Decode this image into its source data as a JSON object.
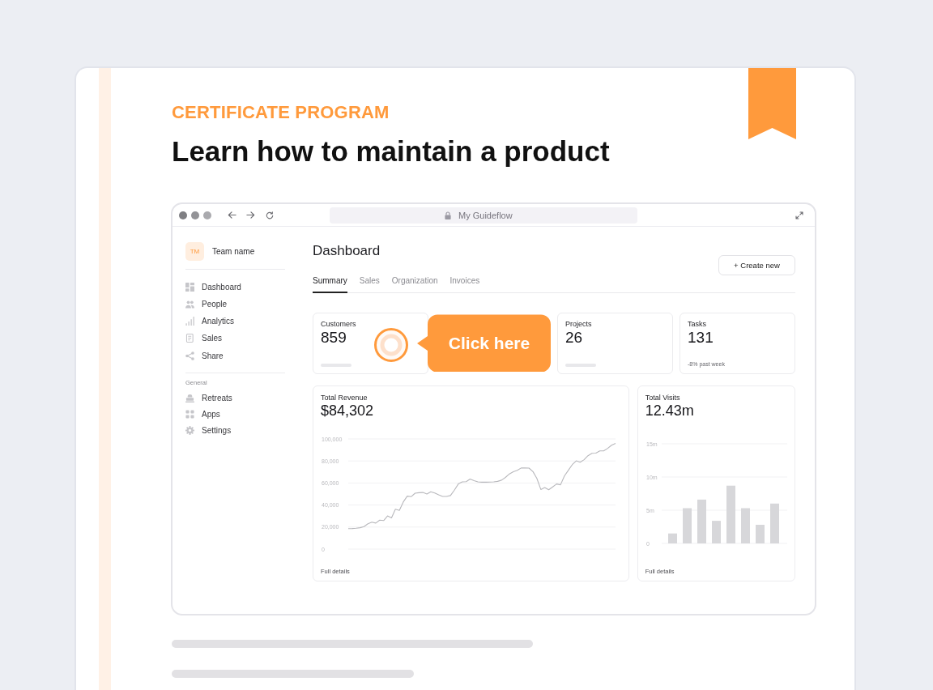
{
  "certificate": {
    "eyebrow": "CERTIFICATE PROGRAM",
    "title": "Learn how to maintain a product"
  },
  "browser": {
    "address": "My Guideflow"
  },
  "sidebar": {
    "team": {
      "initials": "TM",
      "name": "Team name"
    },
    "sections": [
      {
        "items": [
          "Dashboard",
          "People",
          "Analytics",
          "Sales",
          "Share"
        ]
      },
      {
        "heading": "General",
        "items": [
          "Retreats",
          "Apps",
          "Settings"
        ]
      }
    ]
  },
  "dashboard": {
    "title": "Dashboard",
    "create_button": "+ Create new",
    "tabs": [
      {
        "label": "Summary",
        "selected": true
      },
      {
        "label": "Sales",
        "selected": false
      },
      {
        "label": "Organization",
        "selected": false
      },
      {
        "label": "Invoices",
        "selected": false
      }
    ],
    "stats": [
      {
        "label": "Customers",
        "value": "859",
        "kind": "bar"
      },
      {
        "label": "Projects",
        "value": "26",
        "kind": "bar"
      },
      {
        "label": "Tasks",
        "value": "131",
        "kind": "note",
        "note": "-8% past week"
      }
    ],
    "tooltip": {
      "text": "Click here"
    },
    "charts": [
      {
        "title": "Total Revenue",
        "value": "$84,302",
        "link": "Full details",
        "chart_data": {
          "type": "line",
          "ylim": [
            0,
            100000
          ],
          "yticks": [
            {
              "value": 0,
              "label": "0"
            },
            {
              "value": 20000,
              "label": "20,000"
            },
            {
              "value": 40000,
              "label": "40,000"
            },
            {
              "value": 60000,
              "label": "60,000"
            },
            {
              "value": 80000,
              "label": "80,000"
            },
            {
              "value": 100000,
              "label": "100,000"
            }
          ],
          "tick_labels": "y",
          "grid": true,
          "color": "#b8b8bc",
          "values": [
            18600,
            18700,
            18900,
            19400,
            20400,
            23000,
            24500,
            23600,
            26300,
            25900,
            30100,
            28300,
            36200,
            35100,
            42700,
            48100,
            47600,
            50700,
            51200,
            51400,
            50100,
            52000,
            50900,
            49200,
            47800,
            47800,
            48600,
            53500,
            59100,
            61000,
            61200,
            63600,
            62100,
            61000,
            60700,
            60700,
            60800,
            61000,
            61500,
            62600,
            65100,
            68200,
            70200,
            71500,
            73600,
            73700,
            73500,
            70300,
            64200,
            54100,
            55900,
            53800,
            56500,
            59100,
            58400,
            66400,
            71600,
            76700,
            80100,
            78900,
            81200,
            84800,
            86900,
            87100,
            89100,
            89100,
            91500,
            94300,
            96000
          ]
        }
      },
      {
        "title": "Total Visits",
        "value": "12.43m",
        "link": "Full details",
        "chart_data": {
          "type": "bar",
          "ylim": [
            0,
            15
          ],
          "yticks": [
            {
              "value": 0,
              "label": "0"
            },
            {
              "value": 5,
              "label": "5m"
            },
            {
              "value": 10,
              "label": "10m"
            },
            {
              "value": 15,
              "label": "15m"
            }
          ],
          "tick_labels": "y",
          "grid": true,
          "color": "#d7d7da",
          "values": [
            1.5,
            5.3,
            6.6,
            3.4,
            8.7,
            5.3,
            2.8,
            6.0
          ]
        }
      }
    ]
  }
}
